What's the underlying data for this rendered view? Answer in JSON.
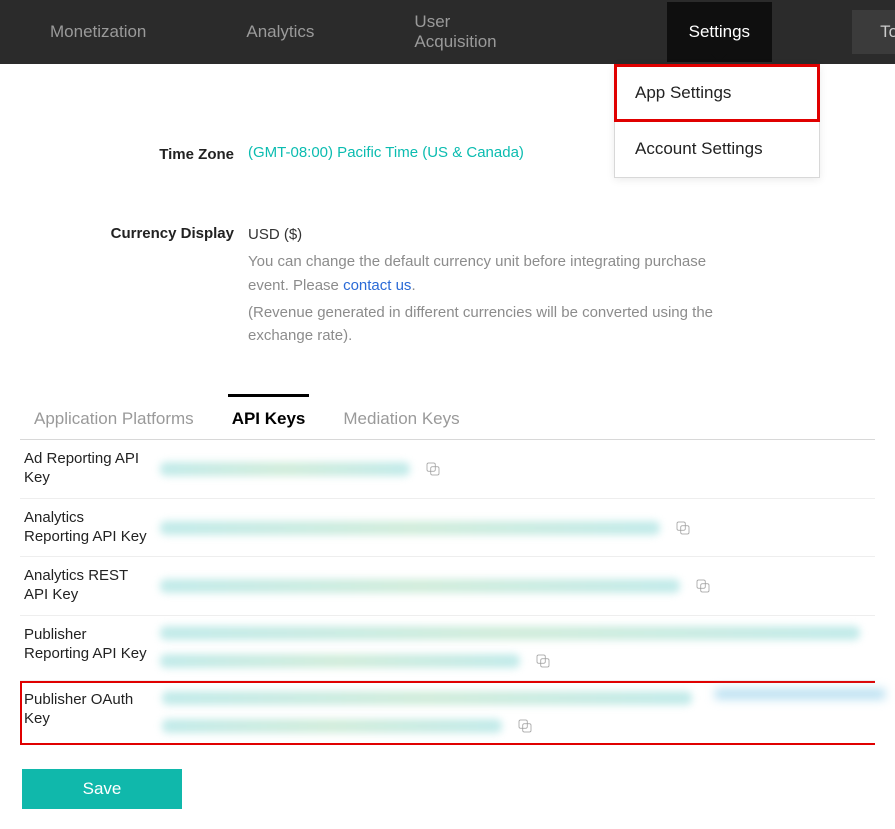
{
  "nav": {
    "monetization": "Monetization",
    "analytics": "Analytics",
    "user_acquisition": "User Acquisition",
    "settings": "Settings",
    "tools": "Tools"
  },
  "dropdown": {
    "app_settings": "App Settings",
    "account_settings": "Account Settings"
  },
  "form": {
    "timezone_label": "Time Zone",
    "timezone_value": "(GMT-08:00) Pacific Time (US & Canada)",
    "currency_label": "Currency Display",
    "currency_value": "USD ($)",
    "currency_hint_1": "You can change the default currency unit before integrating purchase event. Please ",
    "contact_link": "contact us",
    "currency_hint_1b": ".",
    "currency_hint_2": "(Revenue generated in different currencies will be converted using the exchange rate)."
  },
  "tabs": {
    "platforms": "Application Platforms",
    "api_keys": "API Keys",
    "mediation": "Mediation Keys"
  },
  "keys": {
    "ad_reporting": "Ad Reporting API Key",
    "analytics_reporting": "Analytics Reporting API Key",
    "analytics_rest": "Analytics REST API Key",
    "publisher_reporting": "Publisher Reporting API Key",
    "publisher_oauth": "Publisher OAuth Key"
  },
  "buttons": {
    "save": "Save"
  }
}
